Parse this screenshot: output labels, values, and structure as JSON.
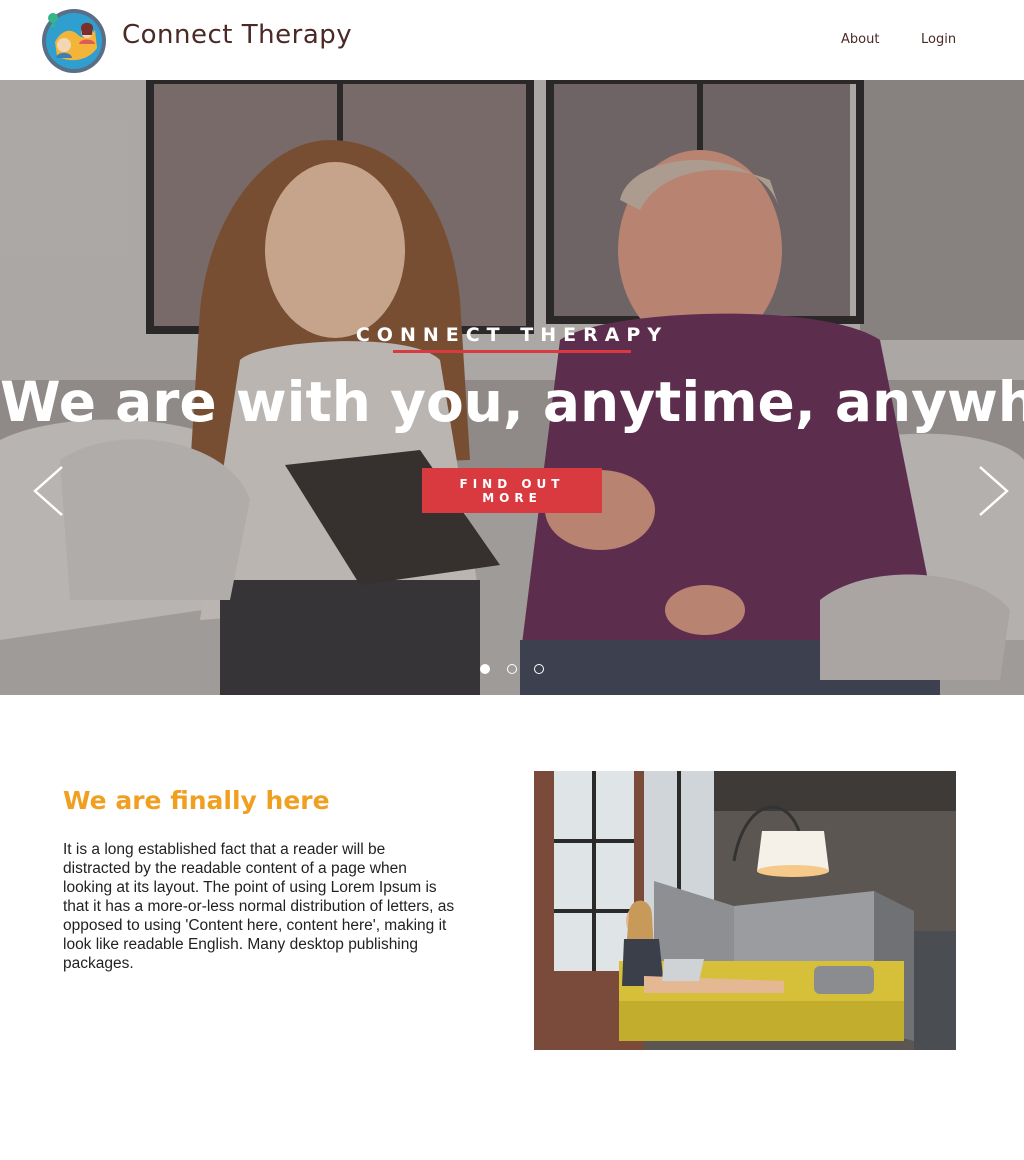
{
  "header": {
    "brand": "Connect Therapy",
    "logo_icon": "connect-therapy-logo-icon",
    "nav": [
      {
        "label": "About"
      },
      {
        "label": "Login"
      }
    ]
  },
  "hero": {
    "kicker": "CONNECT THERAPY",
    "headline": "We are with you, anytime, anywhere",
    "cta_label": "FIND OUT MORE",
    "prev_icon": "chevron-left-icon",
    "next_icon": "chevron-right-icon",
    "slides": 3,
    "active_slide": 1,
    "accent_color": "#d93a3f"
  },
  "intro": {
    "title": "We are finally here",
    "body": "It is a long established fact that a reader will be distracted by the readable content of a page when looking at its layout. The point of using Lorem Ipsum is that it has a more-or-less normal distribution of letters, as opposed to using 'Content here, content here', making it look like readable English. Many desktop publishing packages.",
    "title_color": "#f0a020"
  }
}
